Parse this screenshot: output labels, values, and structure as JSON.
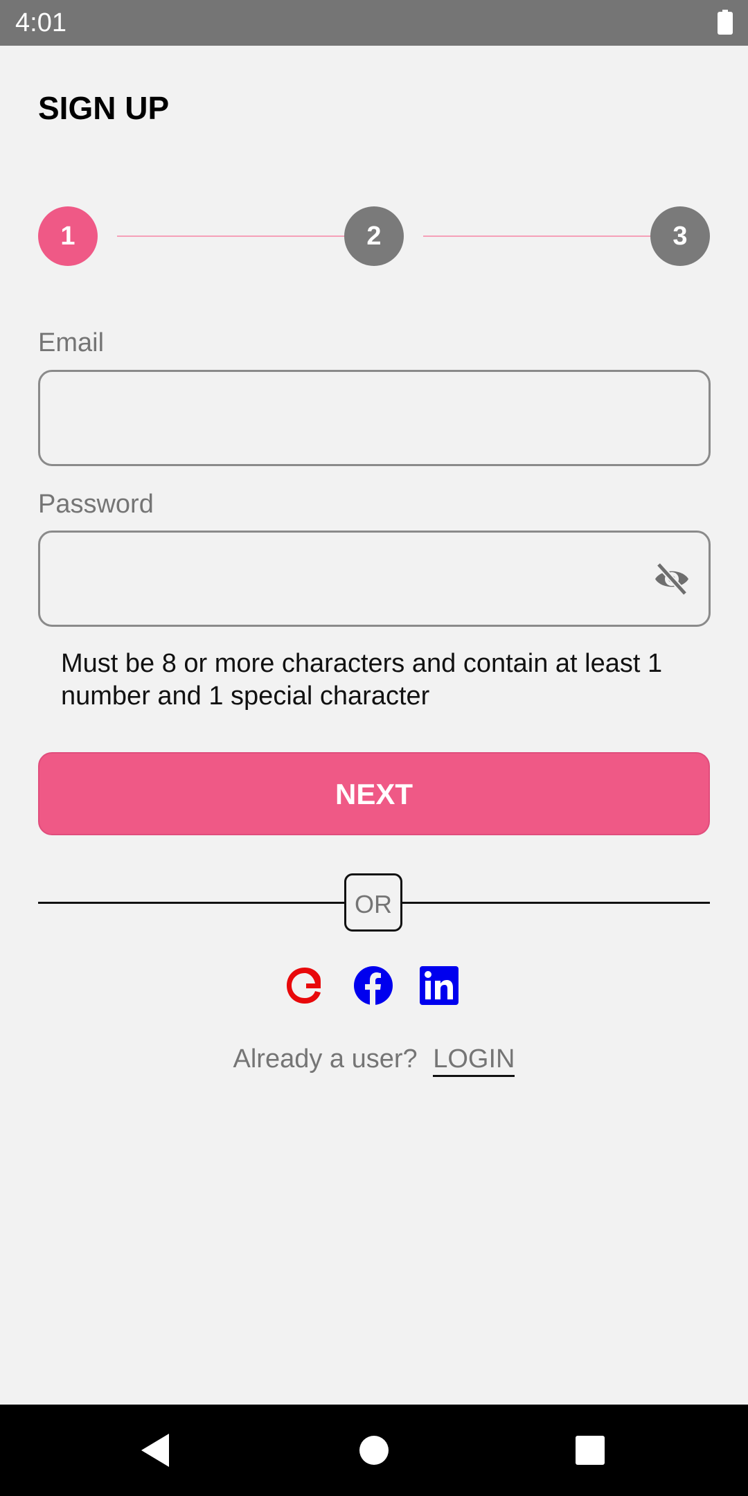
{
  "status_bar": {
    "time": "4:01",
    "battery_icon": "battery-full-icon"
  },
  "page": {
    "title": "SIGN UP"
  },
  "stepper": {
    "steps": [
      {
        "label": "1",
        "active": true
      },
      {
        "label": "2",
        "active": false
      },
      {
        "label": "3",
        "active": false
      }
    ]
  },
  "form": {
    "email": {
      "label": "Email",
      "value": "",
      "placeholder": ""
    },
    "password": {
      "label": "Password",
      "value": "",
      "placeholder": "",
      "toggle_icon": "eye-off-icon"
    },
    "hint": "Must be 8 or more characters and contain at least 1 number and 1 special character"
  },
  "actions": {
    "next_label": "NEXT",
    "or_label": "OR",
    "social": [
      {
        "name": "google-icon",
        "color": "#e8090b"
      },
      {
        "name": "facebook-icon",
        "color": "#0000ee"
      },
      {
        "name": "linkedin-icon",
        "color": "#0000ee"
      }
    ]
  },
  "footer": {
    "prompt": "Already a user?",
    "login_label": "LOGIN"
  },
  "colors": {
    "accent": "#ef5986",
    "inactive_step": "#7a7a7a",
    "step_line": "#f5a0b8",
    "status_bar": "#757575",
    "background": "#f2f2f2"
  },
  "nav_bar": {
    "back_icon": "back-triangle-icon",
    "home_icon": "home-circle-icon",
    "recents_icon": "recents-square-icon"
  }
}
